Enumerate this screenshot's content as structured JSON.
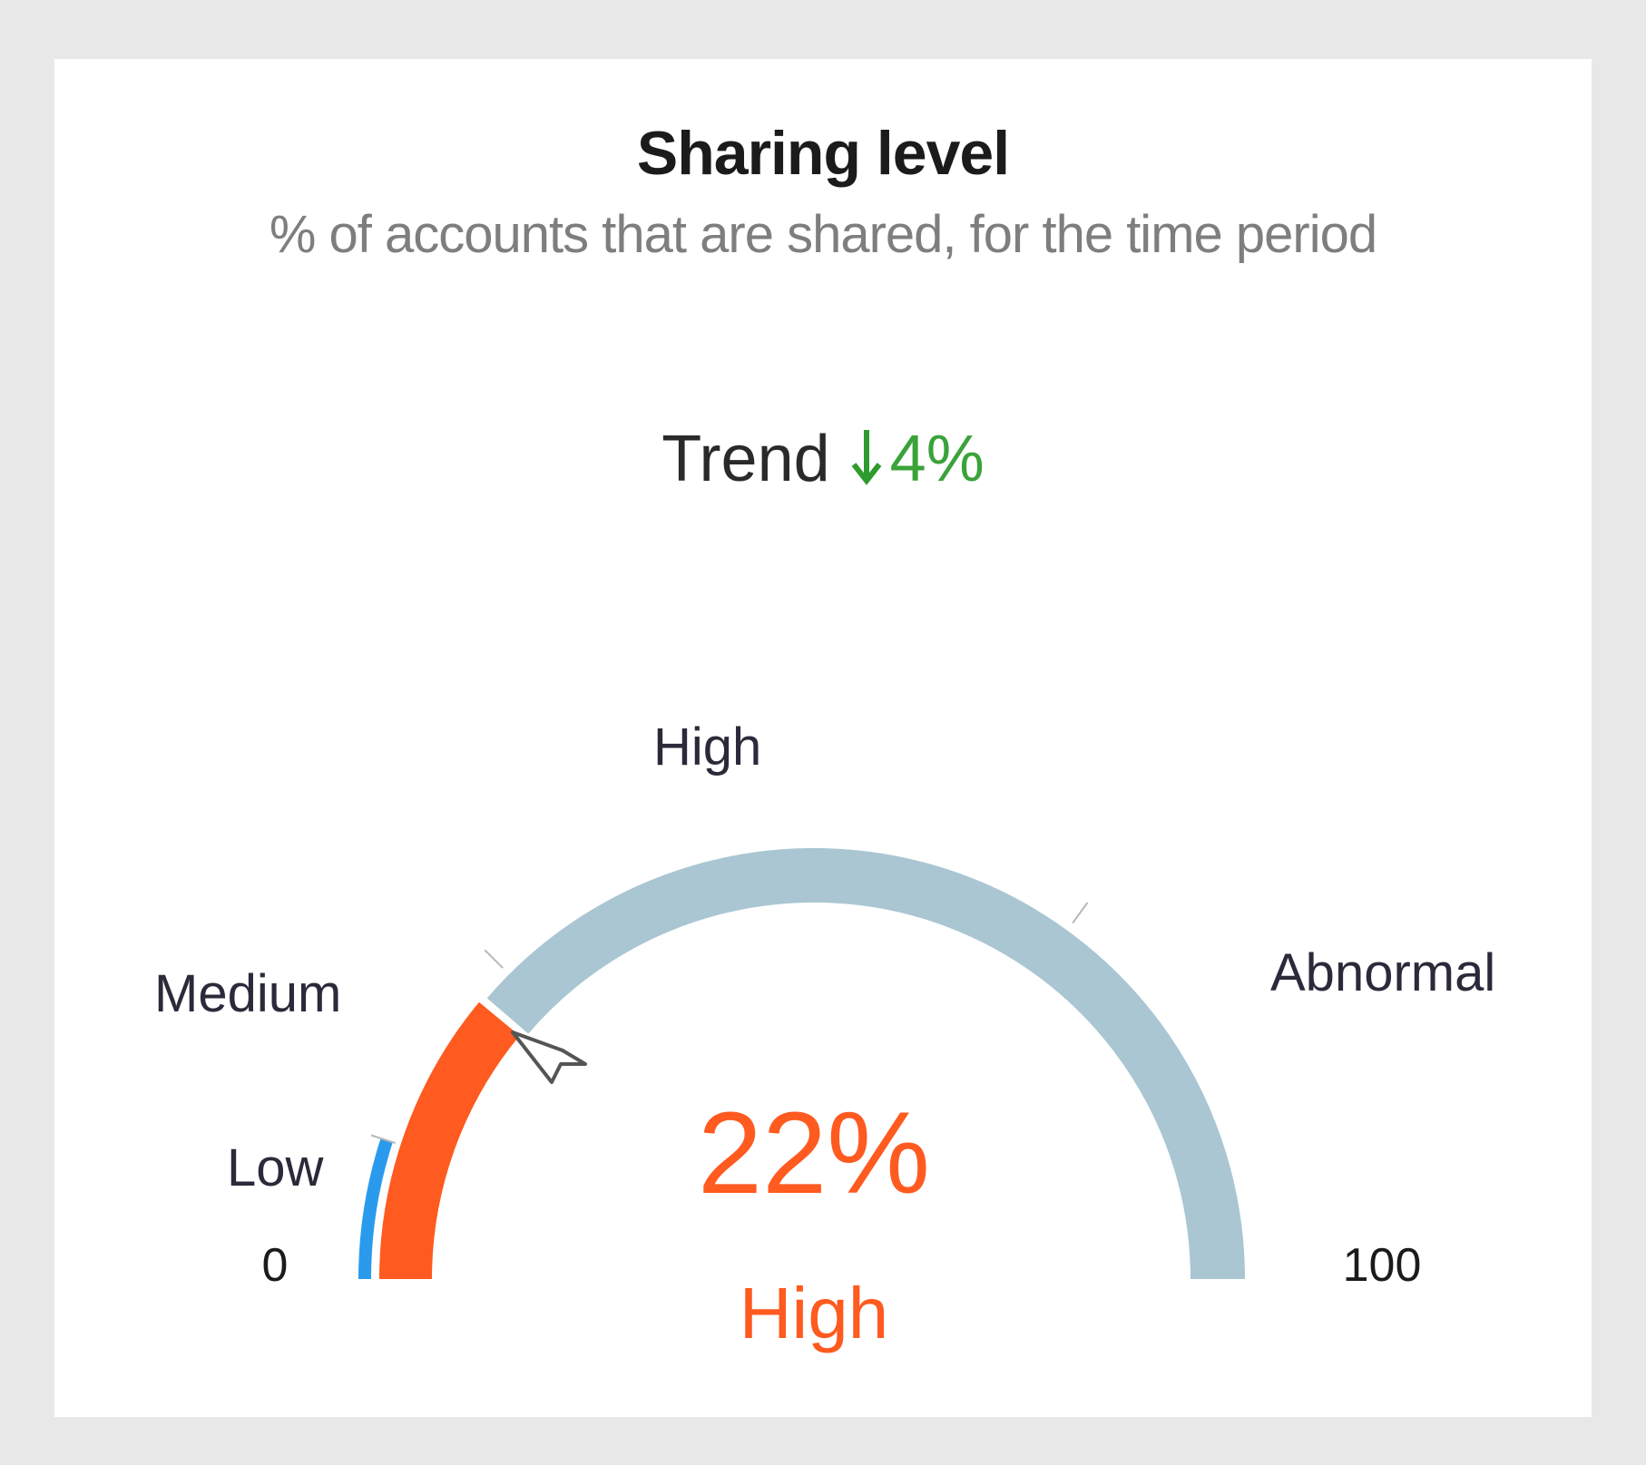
{
  "card": {
    "title": "Sharing level",
    "subtitle": "% of accounts that are shared, for the time period"
  },
  "trend": {
    "label": "Trend",
    "direction_icon": "arrow-down-icon",
    "value": "4%",
    "color": "#2e9b2e"
  },
  "gauge": {
    "min_label": "0",
    "max_label": "100",
    "value": 22,
    "value_label": "22%",
    "level_label": "High",
    "level_color": "#ff5a1f",
    "track_color": "#a9c6d2",
    "low_color": "#2a9bec",
    "bands": [
      {
        "label": "Low",
        "from": 0,
        "to": 10
      },
      {
        "label": "Medium",
        "from": 10,
        "to": 25
      },
      {
        "label": "High",
        "from": 25,
        "to": 70
      },
      {
        "label": "Abnormal",
        "from": 70,
        "to": 100
      }
    ]
  }
}
